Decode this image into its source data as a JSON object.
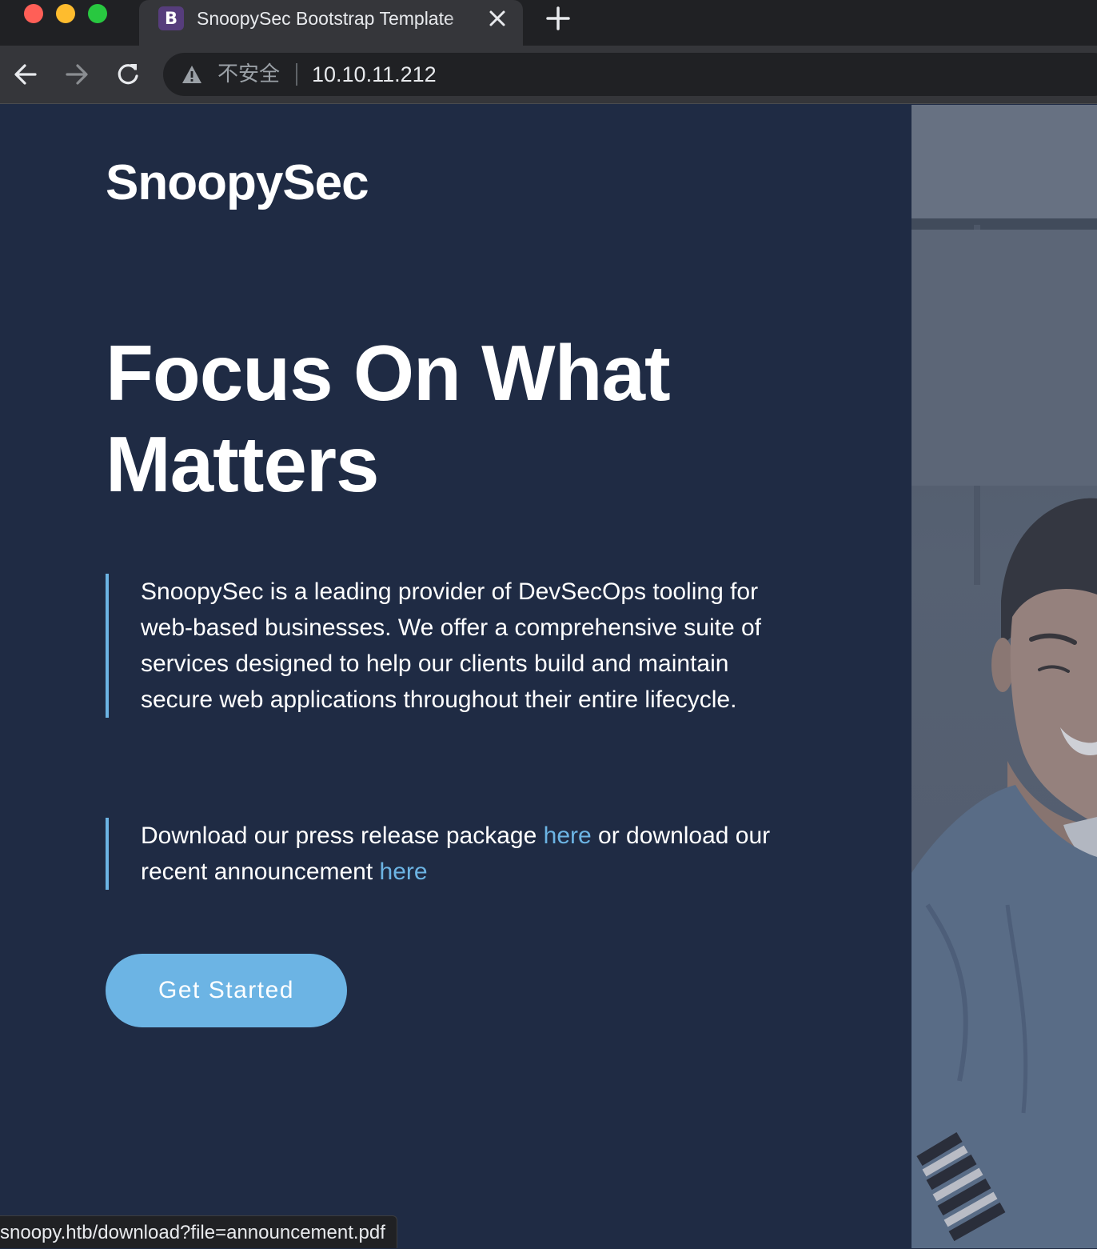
{
  "browser": {
    "tab_favicon": "B",
    "tab_title": "SnoopySec Bootstrap Template",
    "security_label": "不安全",
    "url": "10.10.11.212",
    "status_url": "snoopy.htb/download?file=announcement.pdf",
    "icons": [
      "close-icon",
      "plus-icon",
      "back-arrow-icon",
      "forward-arrow-icon",
      "reload-icon",
      "warning-icon"
    ]
  },
  "hero": {
    "logo": "SnoopySec",
    "headline_line1": "Focus On What",
    "headline_line2": "Matters",
    "description": "SnoopySec is a leading provider of DevSecOps tooling for web-based businesses. We offer a comprehensive suite of services designed to help our clients build and maintain secure web applications throughout their entire lifecycle.",
    "download_prefix": "Download our press release package ",
    "download_link1": "here",
    "download_middle": " or download our recent announcement ",
    "download_link2": "here",
    "cta_label": "Get Started"
  },
  "colors": {
    "hero_background": "#1f2b44",
    "accent": "#6cb4e4",
    "text": "#ffffff",
    "favicon": "#563d7c"
  }
}
